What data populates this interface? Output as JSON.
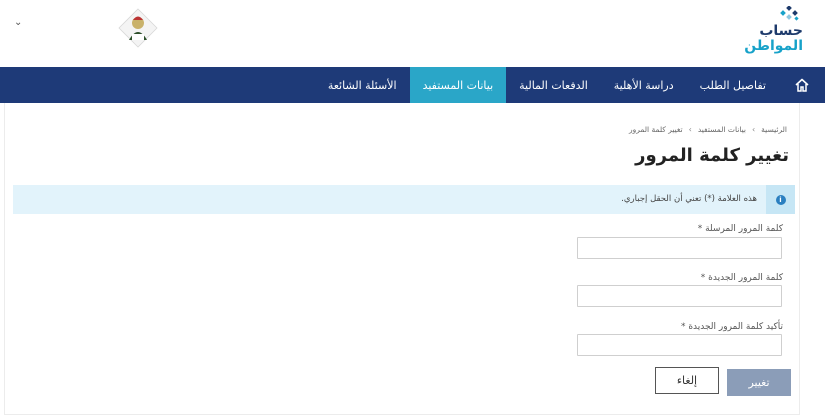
{
  "header": {
    "logo_line1": "حساب",
    "logo_line2": "المواطن",
    "user_menu_chevron": "⌄",
    "emblem_icon": "saudi-royal-emblem-icon"
  },
  "nav": {
    "home_icon": "home-icon",
    "items": [
      {
        "label": "تفاصيل الطلب",
        "active": false
      },
      {
        "label": "دراسة الأهلية",
        "active": false
      },
      {
        "label": "الدفعات المالية",
        "active": false
      },
      {
        "label": "بيانات المستفيد",
        "active": true
      },
      {
        "label": "الأسئلة الشائعة",
        "active": false
      }
    ]
  },
  "breadcrumb": {
    "items": [
      "الرئيسية",
      "بيانات المستفيد",
      "تغيير كلمة المرور"
    ],
    "separator": "›"
  },
  "page_title": "تغيير كلمة المرور",
  "info_message": "هذه العلامة (*) تعني أن الحقل إجباري.",
  "form": {
    "fields": [
      {
        "label": "كلمة المرور المرسلة *",
        "value": ""
      },
      {
        "label": "كلمة المرور الجديدة *",
        "value": ""
      },
      {
        "label": "تأكيد كلمة المرور الجديدة *",
        "value": ""
      }
    ],
    "submit_label": "تغيير",
    "cancel_label": "إلغاء"
  },
  "colors": {
    "nav_bg": "#1e3a78",
    "nav_active": "#2aa6c8",
    "info_bg": "#e2f3fb",
    "submit_bg": "#8b9db8"
  }
}
